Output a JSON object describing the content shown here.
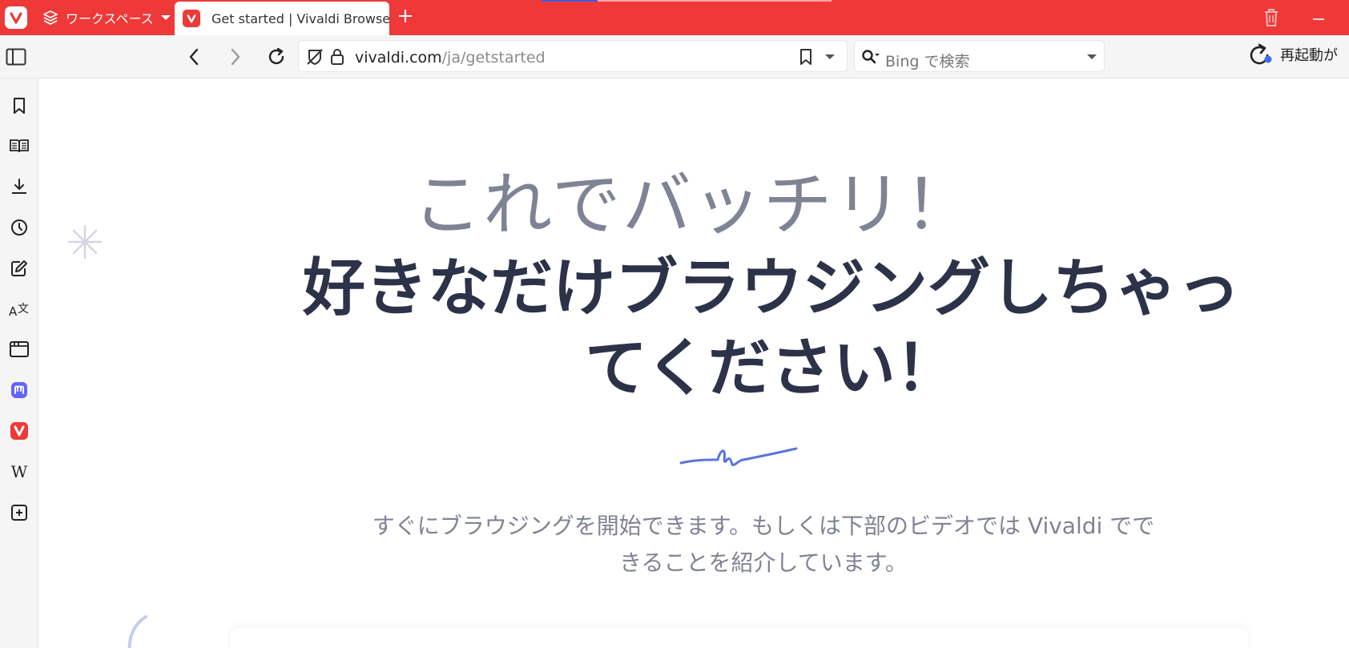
{
  "colors": {
    "brand_red": "#ef3939",
    "heading_light": "#7e8494",
    "heading_dark": "#2c3248",
    "accent_blue": "#5b74e0",
    "mastodon_purple": "#6364ff"
  },
  "tabbar": {
    "workspace_label": "ワークスペース",
    "active_tab_title": "Get started | Vivaldi Browser",
    "new_tab_icon": "plus-icon",
    "trash_icon": "trash-icon",
    "minimize_icon": "minimize-icon"
  },
  "addressbar": {
    "url_host": "vivaldi.com",
    "url_path": "/ja/getstarted",
    "search_placeholder": "Bing で検索",
    "restart_label": "再起動が"
  },
  "sidebar": {
    "items": [
      {
        "name": "bookmarks",
        "icon": "bookmark-icon"
      },
      {
        "name": "reading-list",
        "icon": "book-icon"
      },
      {
        "name": "downloads",
        "icon": "download-icon"
      },
      {
        "name": "history",
        "icon": "clock-icon"
      },
      {
        "name": "notes",
        "icon": "notes-icon"
      },
      {
        "name": "translate",
        "icon": "translate-icon"
      },
      {
        "name": "window",
        "icon": "window-icon"
      },
      {
        "name": "mastodon",
        "icon": "mastodon-icon"
      },
      {
        "name": "vivaldi",
        "icon": "vivaldi-icon"
      },
      {
        "name": "wikipedia",
        "icon": "wikipedia-icon",
        "glyph": "W"
      },
      {
        "name": "add-panel",
        "icon": "add-icon"
      }
    ]
  },
  "page": {
    "heading_light": "これでバッチリ！",
    "heading_bold_line1": "好きなだけブラウジングしちゃっ",
    "heading_bold_line2": "てください！",
    "subtext_line1": "すぐにブラウジングを開始できます。もしくは下部のビデオでは Vivaldi でで",
    "subtext_line2": "きることを紹介しています。"
  }
}
